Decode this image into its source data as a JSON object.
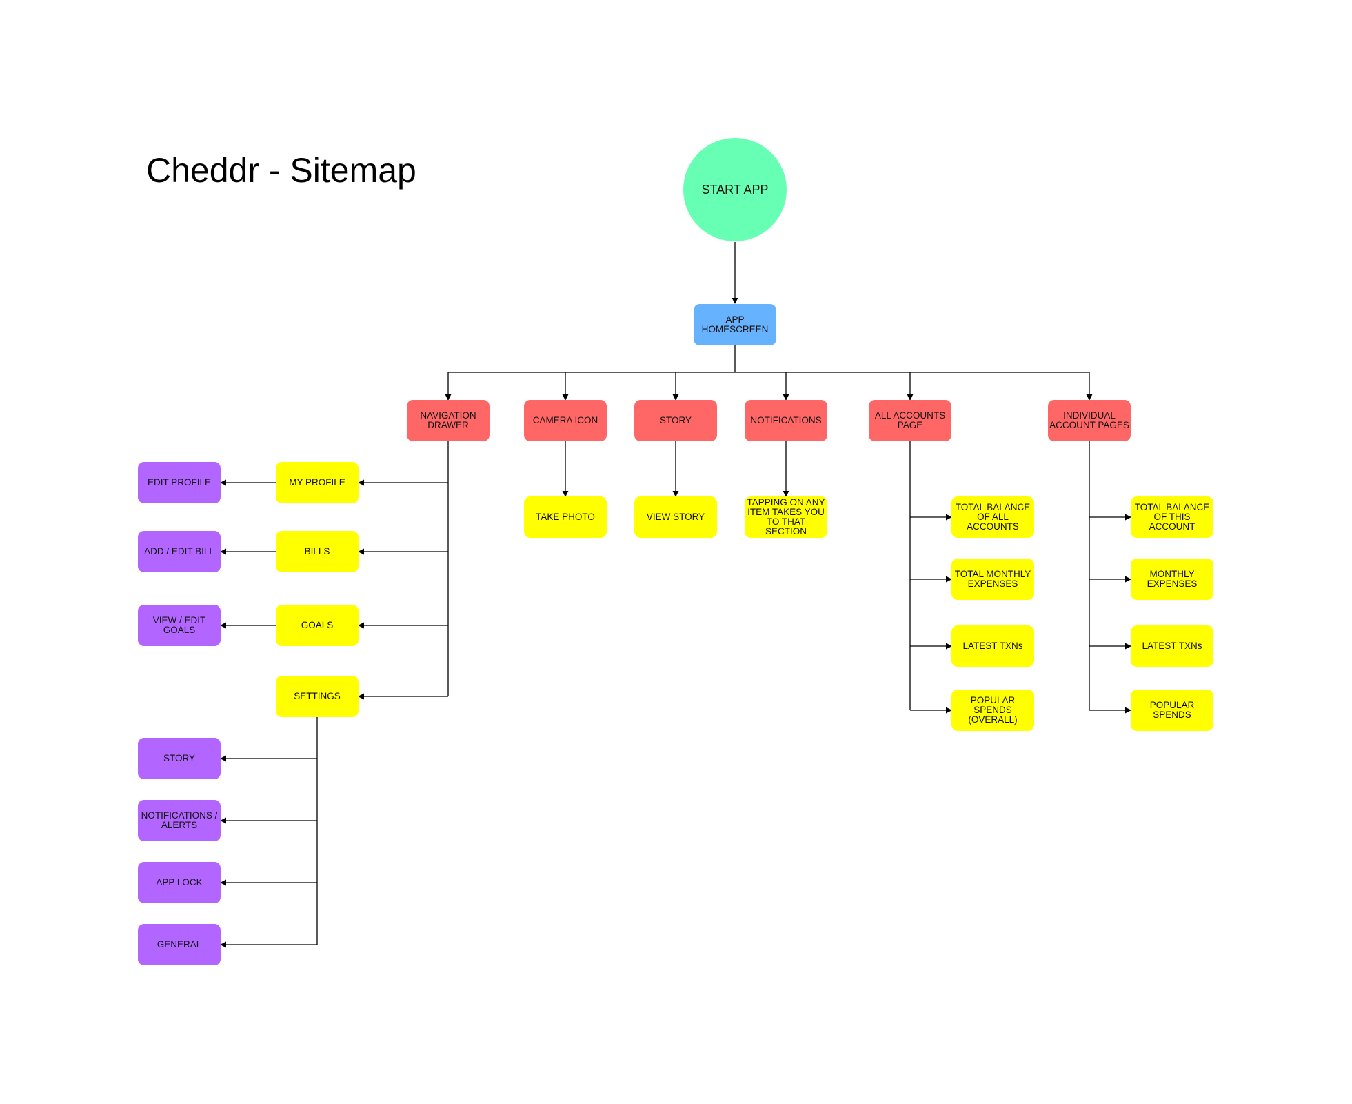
{
  "title": "Cheddr - Sitemap",
  "colors": {
    "start": "#66ffb3",
    "home": "#66b2ff",
    "section": "#ff6666",
    "page": "#ffff00",
    "subpage": "#b266ff",
    "connector": "#000000"
  },
  "nodes": {
    "start_app": "START APP",
    "app_homescreen": "APP HOMESCREEN",
    "navigation_drawer": "NAVIGATION DRAWER",
    "camera_icon": "CAMERA ICON",
    "story": "STORY",
    "notifications": "NOTIFICATIONS",
    "all_accounts_page": "ALL ACCOUNTS PAGE",
    "individual_account_pages": "INDIVIDUAL ACCOUNT PAGES",
    "my_profile": "MY PROFILE",
    "bills": "BILLS",
    "goals": "GOALS",
    "settings": "SETTINGS",
    "edit_profile": "EDIT PROFILE",
    "add_edit_bill": "ADD / EDIT BILL",
    "view_edit_goals": "VIEW / EDIT GOALS",
    "settings_story": "STORY",
    "notifications_alerts": "NOTIFICATIONS / ALERTS",
    "app_lock": "APP LOCK",
    "general": "GENERAL",
    "take_photo": "TAKE PHOTO",
    "view_story": "VIEW STORY",
    "tapping_item": "TAPPING ON ANY ITEM TAKES YOU TO THAT SECTION",
    "total_balance_all": "TOTAL BALANCE OF ALL ACCOUNTS",
    "total_monthly_expenses": "TOTAL MONTHLY EXPENSES",
    "latest_txns_all": "LATEST TXNs",
    "popular_spends_overall": "POPULAR SPENDS (OVERALL)",
    "total_balance_this": "TOTAL BALANCE OF THIS ACCOUNT",
    "monthly_expenses": "MONTHLY EXPENSES",
    "latest_txns_individual": "LATEST TXNs",
    "popular_spends": "POPULAR SPENDS"
  }
}
